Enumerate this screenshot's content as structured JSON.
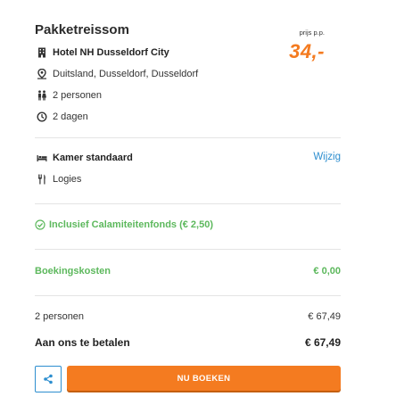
{
  "summary": {
    "title": "Pakketreissom",
    "price_label": "prijs p.p.",
    "price": "34,-"
  },
  "details": {
    "hotel": "Hotel NH Dusseldorf City",
    "location": "Duitsland, Dusseldorf, Dusseldorf",
    "persons": "2 personen",
    "duration": "2 dagen"
  },
  "room": {
    "type": "Kamer standaard",
    "board": "Logies",
    "change_label": "Wijzig"
  },
  "inclusive": {
    "text": "Inclusief Calamiteitenfonds (€ 2,50)"
  },
  "booking_costs": {
    "label": "Boekingskosten",
    "value": "€ 0,00"
  },
  "totals": {
    "persons_label": "2 personen",
    "persons_value": "€ 67,49",
    "pay_label": "Aan ons te betalen",
    "pay_value": "€ 67,49"
  },
  "actions": {
    "book_label": "NU BOEKEN"
  },
  "colors": {
    "accent": "#f47b20",
    "link": "#2d8ecf",
    "green": "#5cb85c"
  }
}
